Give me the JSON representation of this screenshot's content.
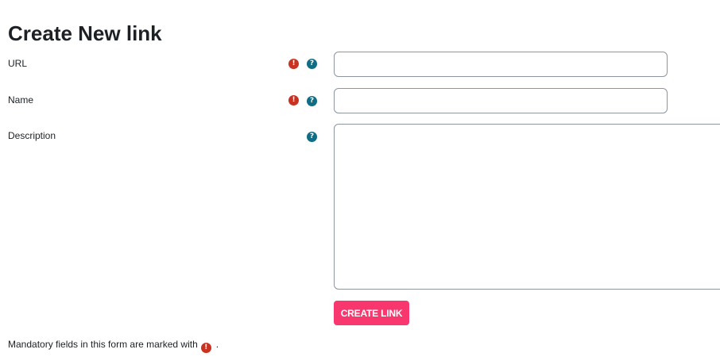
{
  "page": {
    "title": "Create New link"
  },
  "form": {
    "url": {
      "label": "URL",
      "value": "",
      "placeholder": "",
      "required": true
    },
    "name": {
      "label": "Name",
      "value": "",
      "placeholder": "",
      "required": true
    },
    "description": {
      "label": "Description",
      "value": "",
      "placeholder": "",
      "required": false
    },
    "submit_label": "CREATE LINK",
    "footnote": {
      "text": "Mandatory fields in this form are marked with",
      "suffix": "."
    }
  },
  "icons": {
    "required": "exclamation-circle-icon",
    "help": "question-circle-icon"
  },
  "colors": {
    "accent": "#f8376e",
    "required": "#ca3120",
    "help": "#0f6e84",
    "text": "#1d2125",
    "input_border": "#8f959e"
  }
}
